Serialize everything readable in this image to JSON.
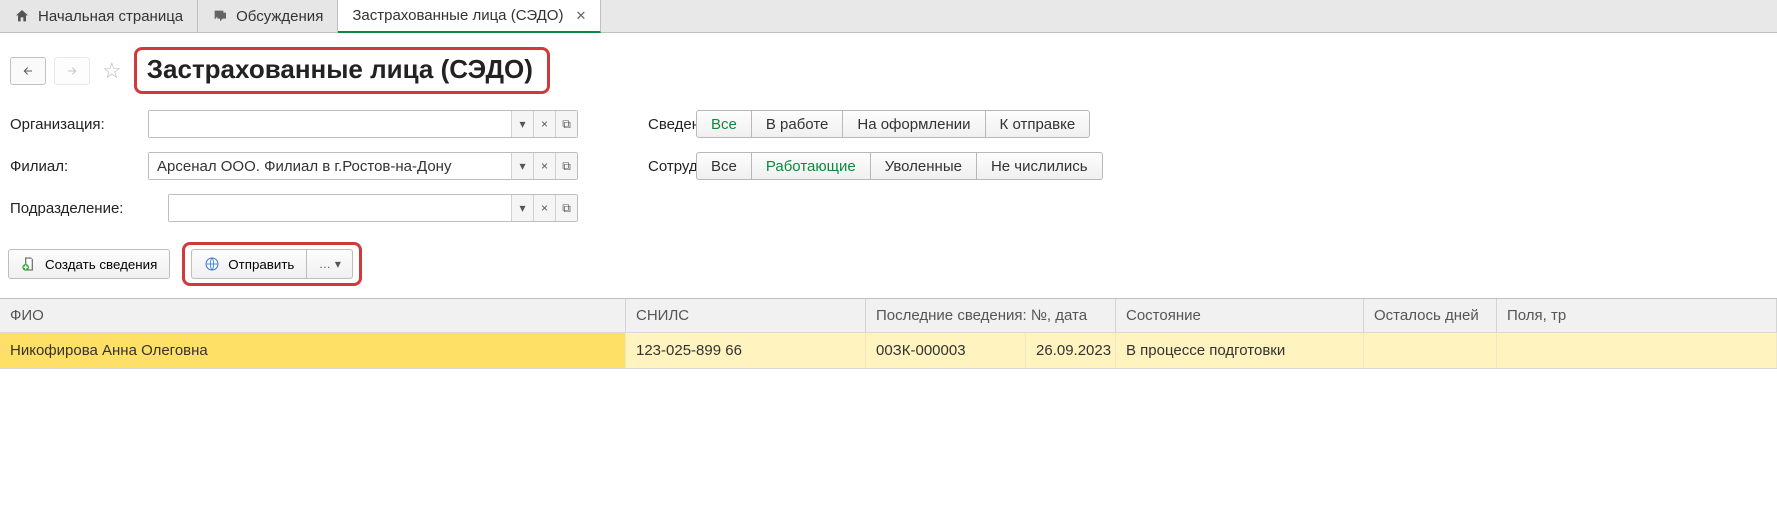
{
  "tabs": [
    {
      "label": "Начальная страница"
    },
    {
      "label": "Обсуждения"
    },
    {
      "label": "Застрахованные лица (СЭДО)"
    }
  ],
  "page_title": "Застрахованные лица (СЭДО)",
  "filters": {
    "org_label": "Организация:",
    "org_value": "",
    "branch_label": "Филиал:",
    "branch_value": "Арсенал ООО. Филиал в г.Ростов-на-Дону",
    "dept_label": "Подразделение:",
    "dept_value": "",
    "svedeniya_label": "Сведения:",
    "svedeniya_opts": [
      "Все",
      "В работе",
      "На оформлении",
      "К отправке"
    ],
    "sotrudniki_label": "Сотрудники:",
    "sotrudniki_opts": [
      "Все",
      "Работающие",
      "Уволенные",
      "Не числились"
    ]
  },
  "toolbar": {
    "create_label": "Создать сведения",
    "send_label": "Отправить",
    "more_label": "…"
  },
  "table": {
    "headers": {
      "fio": "ФИО",
      "snils": "СНИЛС",
      "last_info": "Последние сведения: №, дата",
      "status": "Состояние",
      "days_left": "Осталось дней",
      "fields": "Поля, тр"
    },
    "rows": [
      {
        "fio": "Никофирова Анна Олеговна",
        "snils": "123-025-899 66",
        "num": "00ЗК-000003",
        "date": "26.09.2023",
        "status": "В процессе подготовки",
        "days_left": "",
        "fields": ""
      }
    ]
  }
}
